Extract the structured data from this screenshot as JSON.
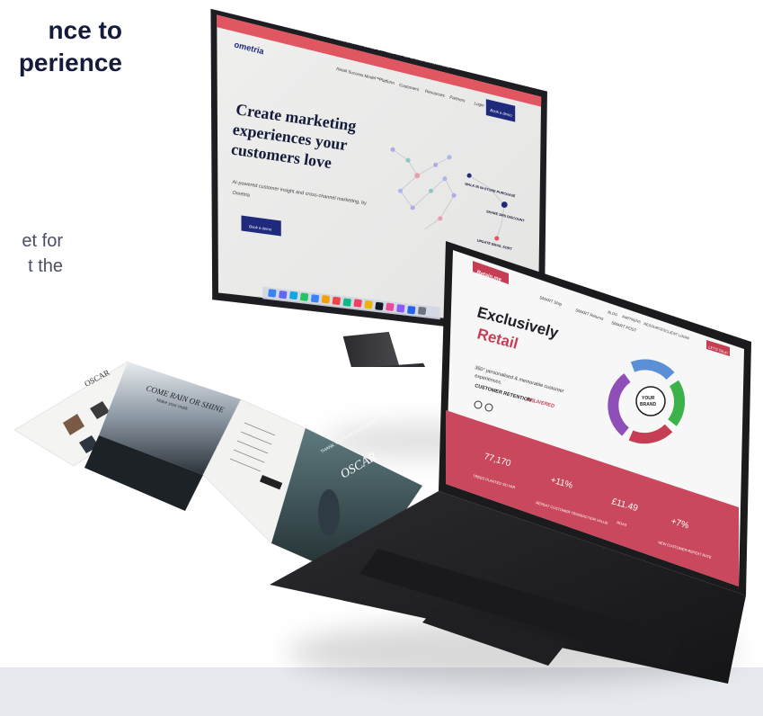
{
  "hero": {
    "headline_line1": "nce to",
    "headline_line2": "perience",
    "body_line1": "et for",
    "body_line2": "t the"
  },
  "monitor_site": {
    "brand": "ometria",
    "announcement": "Ometria raises $40m in Series C – read the full announcement here",
    "nav": [
      "Retail Success Model™",
      "Platform",
      "Customers",
      "Resources",
      "Partners",
      "Login"
    ],
    "cta_nav": "Book a demo",
    "hero_title_lines": [
      "Create marketing",
      "experiences your",
      "customers love"
    ],
    "hero_sub_lines": [
      "AI-powered customer insight and cross-channel marketing, by",
      "Ometria"
    ],
    "hero_cta": "Book a demo",
    "graph_labels": [
      "WALK IN IN-STORE PURCHASE",
      "SHARE SMS DISCOUNT",
      "UPDATE EMAIL SORT"
    ],
    "colors": {
      "accent": "#e05761",
      "navy": "#1f2a7c",
      "screen_bg": "#ebebea"
    }
  },
  "brochure": {
    "brand": "OSCAR",
    "headline": "COME RAIN OR SHINE",
    "sub": "Make your mark",
    "thank_you": "THANK YOU FOR CHOOSING",
    "thank_brand": "OSCAR"
  },
  "laptop_site": {
    "brand": "Retain.me",
    "tabs": [
      "SMART Ship",
      "SMART Returns",
      "SMART POST"
    ],
    "nav": [
      "BLOG",
      "PARTNERS",
      "RESOURCES",
      "CLIENT LOGIN"
    ],
    "cta_nav": "LET'S TALK!",
    "title_line1": "Exclusively",
    "title_line2": "Retail",
    "sub_lines": [
      "360° personalised & memorable customer",
      "experiences."
    ],
    "tagline_prefix": "CUSTOMER RETENTION :",
    "tagline_highlight": "DELIVERED",
    "cycle_center_lines": [
      "YOUR",
      "BRAND"
    ],
    "stats": [
      {
        "value": "77,170",
        "label": "TREES PLANTED SO FAR"
      },
      {
        "value": "+11%",
        "label": "REPEAT CUSTOMER TRANSACTION VALUE"
      },
      {
        "value": "£11.49",
        "label": "ROAS"
      },
      {
        "value": "+7%",
        "label": "NEW CUSTOMER REPEAT RATE"
      }
    ],
    "colors": {
      "accent": "#c63e54",
      "dark": "#1d1d24",
      "stats_bg": "#c9485d"
    }
  }
}
